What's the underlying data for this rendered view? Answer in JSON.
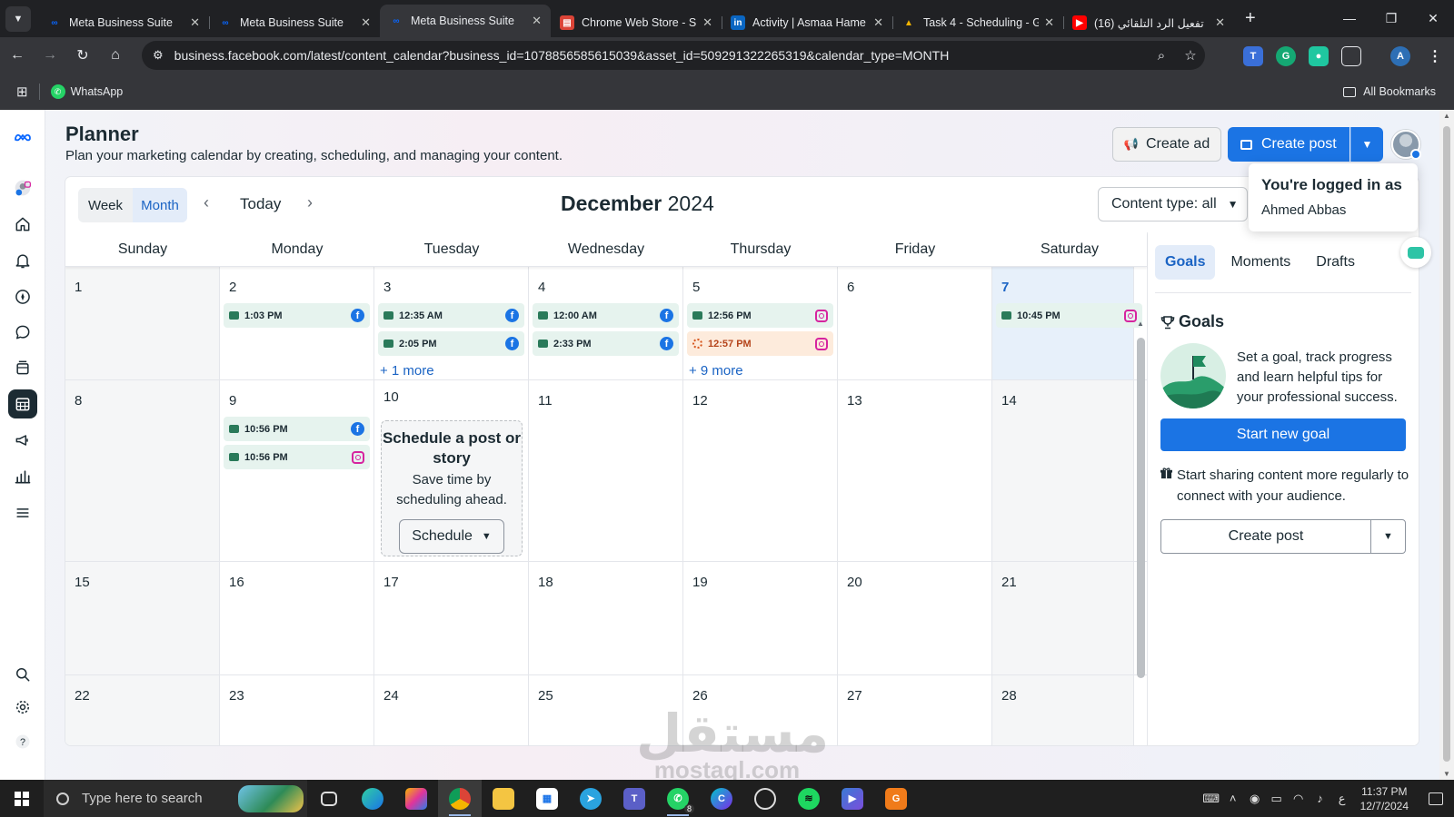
{
  "browser": {
    "tabs": [
      {
        "title": "Meta Business Suite",
        "icon": "meta-icon",
        "active": false
      },
      {
        "title": "Meta Business Suite",
        "icon": "meta-icon",
        "active": false
      },
      {
        "title": "Meta Business Suite",
        "icon": "meta-icon",
        "active": true
      },
      {
        "title": "Chrome Web Store - S",
        "icon": "chrome-web-store-icon",
        "active": false
      },
      {
        "title": "Activity | Asmaa Hame",
        "icon": "linkedin-icon",
        "active": false
      },
      {
        "title": "Task 4 - Scheduling - G",
        "icon": "google-drive-icon",
        "active": false
      },
      {
        "title": "(16) تفعيل الرد التلقائي",
        "icon": "youtube-icon",
        "active": false
      }
    ],
    "url": "business.facebook.com/latest/content_calendar?business_id=1078856585615039&asset_id=509291322265319&calendar_type=MONTH",
    "bookmarks": [
      {
        "label": "WhatsApp",
        "icon": "whatsapp-icon"
      }
    ],
    "all_bookmarks": "All Bookmarks"
  },
  "header": {
    "title": "Planner",
    "subtitle": "Plan your marketing calendar by creating, scheduling, and managing your content.",
    "create_ad": "Create ad",
    "create_post": "Create post"
  },
  "tooltip": {
    "line1": "You're logged in as",
    "line2": "Ahmed Abbas"
  },
  "calendar": {
    "view_tabs": [
      "Week",
      "Month"
    ],
    "selected_view": "Month",
    "today_label": "Today",
    "month": "December",
    "year": "2024",
    "content_type": "Content type: all",
    "weekdays": [
      "Sunday",
      "Monday",
      "Tuesday",
      "Wednesday",
      "Thursday",
      "Friday",
      "Saturday"
    ],
    "weeks": [
      [
        {
          "day": "1",
          "posts": []
        },
        {
          "day": "2",
          "posts": [
            {
              "time": "1:03 PM",
              "platform": "facebook",
              "status": "scheduled"
            }
          ]
        },
        {
          "day": "3",
          "posts": [
            {
              "time": "12:35 AM",
              "platform": "facebook",
              "status": "scheduled"
            },
            {
              "time": "2:05 PM",
              "platform": "facebook",
              "status": "scheduled"
            }
          ],
          "more": "+ 1 more"
        },
        {
          "day": "4",
          "posts": [
            {
              "time": "12:00 AM",
              "platform": "facebook",
              "status": "scheduled"
            },
            {
              "time": "2:33 PM",
              "platform": "facebook",
              "status": "scheduled"
            }
          ]
        },
        {
          "day": "5",
          "posts": [
            {
              "time": "12:56 PM",
              "platform": "instagram",
              "status": "scheduled"
            },
            {
              "time": "12:57 PM",
              "platform": "instagram",
              "status": "pending"
            }
          ],
          "more": "+ 9 more"
        },
        {
          "day": "6",
          "posts": []
        },
        {
          "day": "7",
          "today": true,
          "posts": [
            {
              "time": "10:45 PM",
              "platform": "instagram",
              "status": "scheduled"
            }
          ]
        }
      ],
      [
        {
          "day": "8",
          "posts": []
        },
        {
          "day": "9",
          "posts": [
            {
              "time": "10:56 PM",
              "platform": "facebook",
              "status": "scheduled"
            },
            {
              "time": "10:56 PM",
              "platform": "instagram",
              "status": "scheduled"
            }
          ]
        },
        {
          "day": "10",
          "posts": [],
          "schedule_card": true
        },
        {
          "day": "11",
          "posts": []
        },
        {
          "day": "12",
          "posts": []
        },
        {
          "day": "13",
          "posts": []
        },
        {
          "day": "14",
          "posts": []
        }
      ],
      [
        {
          "day": "15",
          "posts": []
        },
        {
          "day": "16",
          "posts": []
        },
        {
          "day": "17",
          "posts": []
        },
        {
          "day": "18",
          "posts": []
        },
        {
          "day": "19",
          "posts": []
        },
        {
          "day": "20",
          "posts": []
        },
        {
          "day": "21",
          "posts": []
        }
      ],
      [
        {
          "day": "22",
          "posts": []
        },
        {
          "day": "23",
          "posts": []
        },
        {
          "day": "24",
          "posts": []
        },
        {
          "day": "25",
          "posts": []
        },
        {
          "day": "26",
          "posts": []
        },
        {
          "day": "27",
          "posts": []
        },
        {
          "day": "28",
          "posts": []
        }
      ]
    ],
    "schedule_card": {
      "heading": "Schedule a post or story",
      "text": "Save time by scheduling ahead.",
      "button": "Schedule"
    }
  },
  "side_panel": {
    "tabs": [
      "Goals",
      "Moments",
      "Drafts"
    ],
    "selected_tab": "Goals",
    "goals_heading": "Goals",
    "goal_text": "Set a goal, track progress and learn helpful tips for your professional success.",
    "start_goal": "Start new goal",
    "share_text": "Start sharing content more regularly to connect with your audience.",
    "create_post": "Create post"
  },
  "watermark": {
    "arabic": "مستقل",
    "latin": "mostaql.com"
  },
  "taskbar": {
    "search_placeholder": "Type here to search",
    "whatsapp_badge": "8",
    "language": "ع",
    "time": "11:37 PM",
    "date": "12/7/2024"
  },
  "colors": {
    "accent": "#1b74e4",
    "scheduled_bg": "#e6f3ee",
    "pending_bg": "#fdebdc",
    "today_bg": "#e7f0fa"
  }
}
